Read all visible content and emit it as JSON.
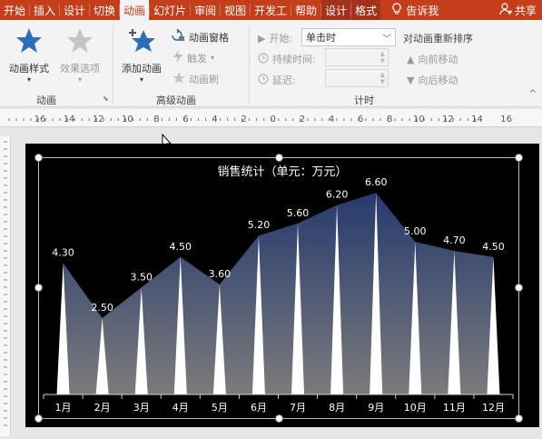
{
  "tabs": [
    "开始",
    "插入",
    "设计",
    "切换",
    "动画",
    "幻灯片",
    "审阅",
    "视图",
    "开发工",
    "帮助",
    "设计",
    "格式"
  ],
  "active_tab": "动画",
  "tell_me": "告诉我",
  "share": "共享",
  "ribbon": {
    "animation_style": "动画样式",
    "effect_options": "效果选项",
    "group_animation": "动画",
    "add_animation": "添加动画",
    "animation_pane": "动画窗格",
    "trigger": "触发",
    "animation_painter": "动画刷",
    "group_advanced": "高级动画",
    "start_label": "开始:",
    "start_value": "单击时",
    "duration_label": "持续时间:",
    "delay_label": "延迟:",
    "group_timing": "计时",
    "reorder_title": "对动画重新排序",
    "move_earlier": "向前移动",
    "move_later": "向后移动"
  },
  "ruler_labels": [
    "16",
    "14",
    "12",
    "10",
    "8",
    "6",
    "4",
    "2",
    "0",
    "2",
    "4",
    "6",
    "8",
    "10",
    "12",
    "14",
    "16"
  ],
  "colors": {
    "accent": "#c43e1c",
    "area_top": "#263a6e",
    "area_bottom": "#7b7b7b"
  },
  "chart_data": {
    "type": "area",
    "title": "销售统计（单元：万元）",
    "categories": [
      "1月",
      "2月",
      "3月",
      "4月",
      "5月",
      "6月",
      "7月",
      "8月",
      "9月",
      "10月",
      "11月",
      "12月"
    ],
    "values": [
      4.3,
      2.5,
      3.5,
      4.5,
      3.6,
      5.2,
      5.6,
      6.2,
      6.6,
      5.0,
      4.7,
      4.5
    ],
    "value_labels": [
      "4.30",
      "2.50",
      "3.50",
      "4.50",
      "3.60",
      "5.20",
      "5.60",
      "6.20",
      "6.60",
      "5.00",
      "4.70",
      "4.50"
    ],
    "ylim": [
      0,
      7.2
    ],
    "grid": false
  }
}
